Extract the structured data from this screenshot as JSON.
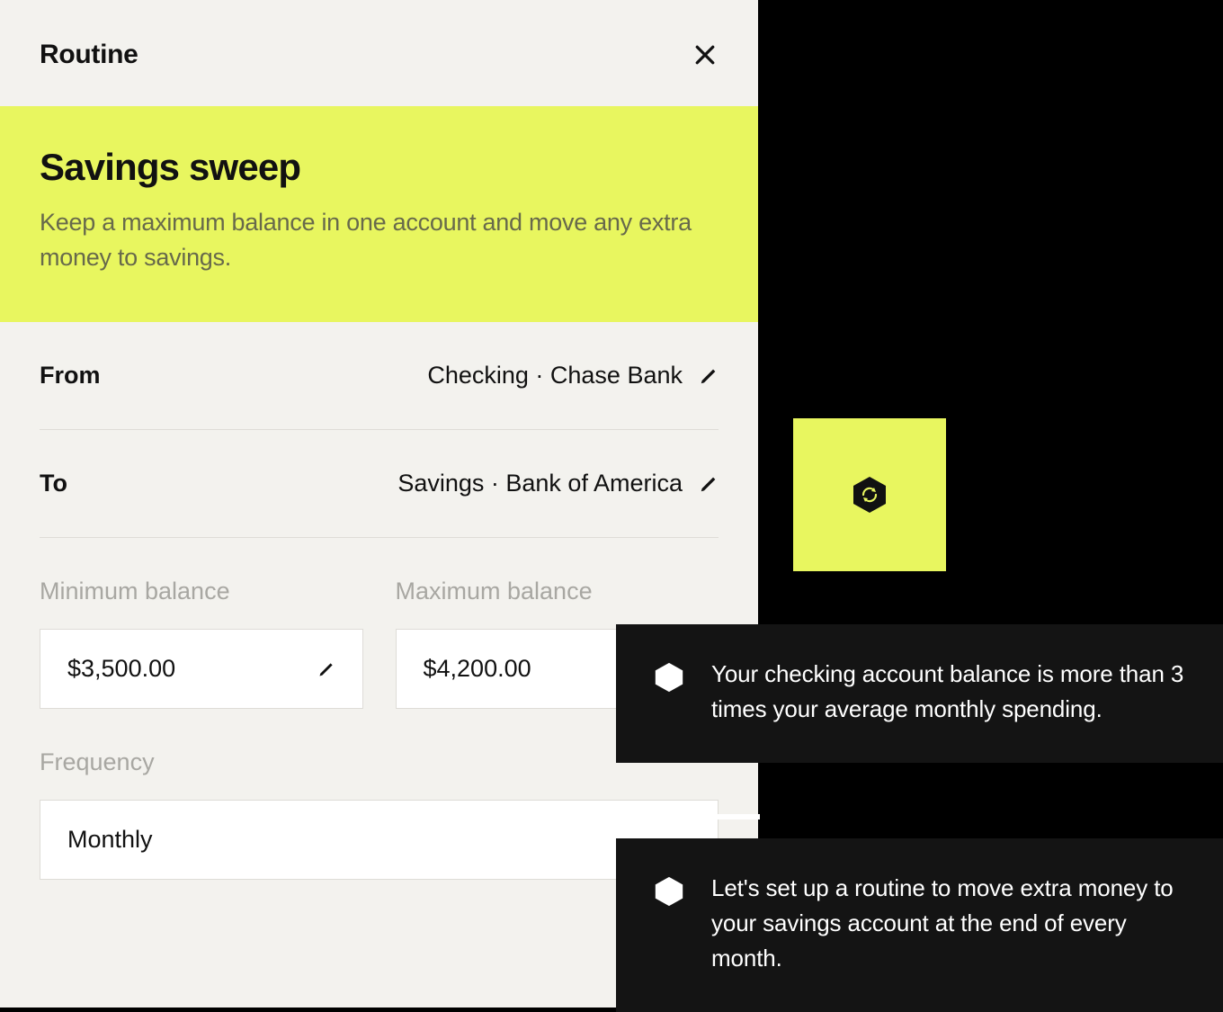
{
  "header": {
    "title": "Routine"
  },
  "banner": {
    "title": "Savings sweep",
    "description": "Keep a maximum balance in one account and move any extra money to savings."
  },
  "accounts": {
    "from_label": "From",
    "from_value": "Checking · Chase Bank",
    "to_label": "To",
    "to_value": "Savings · Bank of America"
  },
  "balances": {
    "min_label": "Minimum balance",
    "min_value": "$3,500.00",
    "max_label": "Maximum balance",
    "max_value": "$4,200.00"
  },
  "frequency": {
    "label": "Frequency",
    "value": "Monthly"
  },
  "notifications": {
    "card1": "Your checking account balance is more than 3 times your average monthly spending.",
    "card2": "Let's set up a routine to move extra money to your savings account at the end of every month."
  },
  "icons": {
    "close": "close-icon",
    "edit": "pencil-icon",
    "sync": "sync-icon",
    "bullet": "hexagon-icon"
  },
  "colors": {
    "accent": "#e8f65f",
    "panel_bg": "#f3f2ee",
    "card_bg": "#141414"
  }
}
